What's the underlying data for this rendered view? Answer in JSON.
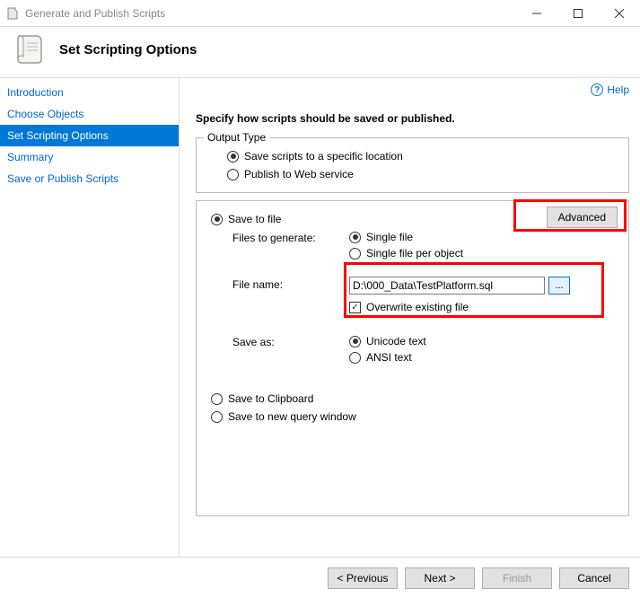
{
  "window": {
    "title": "Generate and Publish Scripts"
  },
  "header": {
    "title": "Set Scripting Options"
  },
  "sidebar": {
    "items": [
      {
        "label": "Introduction",
        "active": false
      },
      {
        "label": "Choose Objects",
        "active": false
      },
      {
        "label": "Set Scripting Options",
        "active": true
      },
      {
        "label": "Summary",
        "active": false
      },
      {
        "label": "Save or Publish Scripts",
        "active": false
      }
    ]
  },
  "help": {
    "label": "Help"
  },
  "subtitle": "Specify how scripts should be saved or published.",
  "output_type": {
    "legend": "Output Type",
    "options": [
      {
        "label": "Save scripts to a specific location",
        "checked": true
      },
      {
        "label": "Publish to Web service",
        "checked": false
      }
    ]
  },
  "save_section": {
    "save_to_file": {
      "label": "Save to file",
      "checked": true
    },
    "advanced_label": "Advanced",
    "files_to_generate": {
      "label": "Files to generate:",
      "options": [
        {
          "label": "Single file",
          "checked": true
        },
        {
          "label": "Single file per object",
          "checked": false
        }
      ]
    },
    "file_name": {
      "label": "File name:",
      "value": "D:\\000_Data\\TestPlatform.sql",
      "browse": "...",
      "overwrite": {
        "label": "Overwrite existing file",
        "checked": true
      }
    },
    "save_as": {
      "label": "Save as:",
      "options": [
        {
          "label": "Unicode text",
          "checked": true
        },
        {
          "label": "ANSI text",
          "checked": false
        }
      ]
    },
    "save_to_clipboard": {
      "label": "Save to Clipboard",
      "checked": false
    },
    "save_to_new_query": {
      "label": "Save to new query window",
      "checked": false
    }
  },
  "footer": {
    "previous": "< Previous",
    "next": "Next >",
    "finish": "Finish",
    "cancel": "Cancel"
  }
}
